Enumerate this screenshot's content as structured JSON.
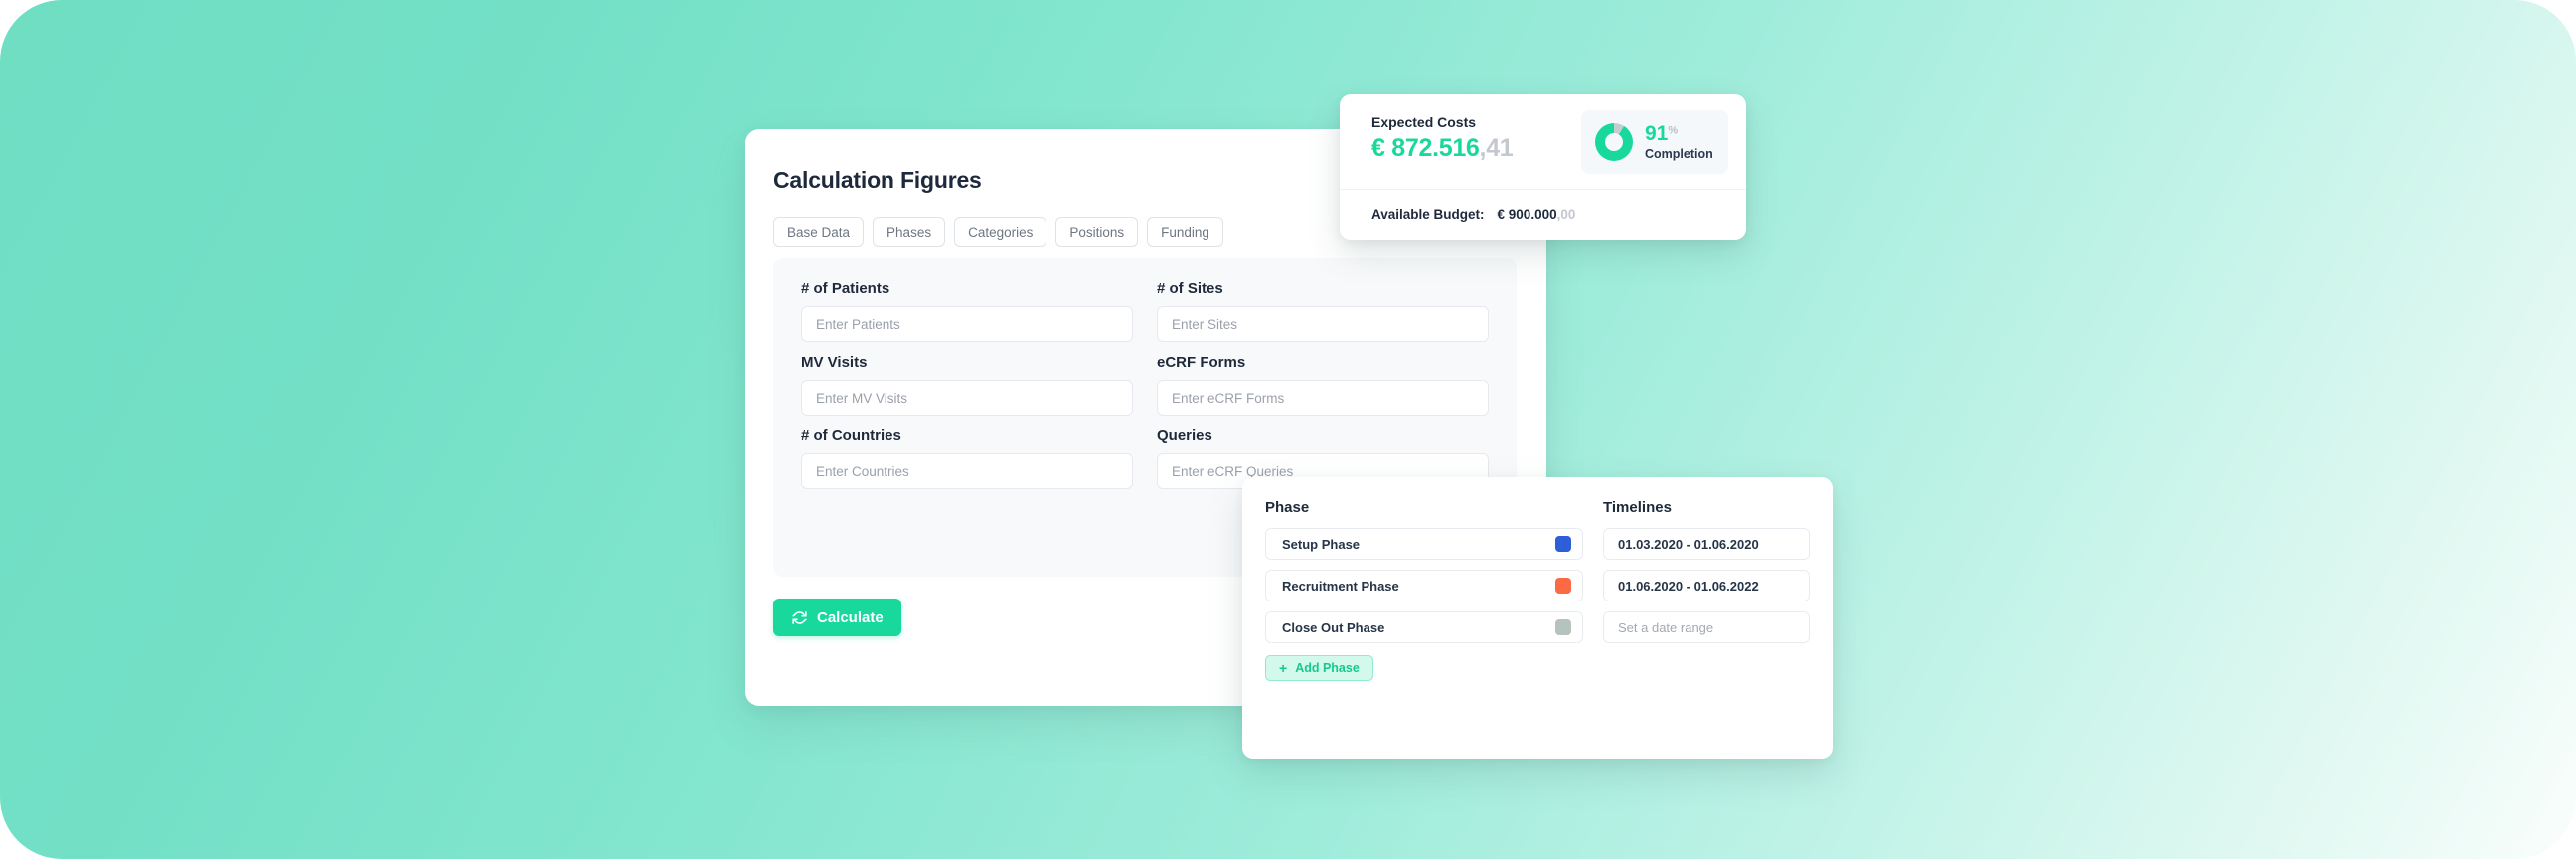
{
  "theme": {
    "accent_green": "#18d99b",
    "gradient_from": "#6fdec3",
    "gradient_to": "#fbfefd",
    "text_dark": "#1e2a3b"
  },
  "main_card": {
    "title": "Calculation Figures",
    "tabs": [
      {
        "label": "Base Data"
      },
      {
        "label": "Phases"
      },
      {
        "label": "Categories"
      },
      {
        "label": "Positions"
      },
      {
        "label": "Funding"
      }
    ],
    "fields": [
      {
        "label": "# of Patients",
        "value": "",
        "placeholder": "Enter Patients"
      },
      {
        "label": "# of Sites",
        "value": "",
        "placeholder": "Enter Sites"
      },
      {
        "label": "MV Visits",
        "value": "",
        "placeholder": "Enter MV Visits"
      },
      {
        "label": "eCRF Forms",
        "value": "",
        "placeholder": "Enter eCRF Forms"
      },
      {
        "label": "# of Countries",
        "value": "",
        "placeholder": "Enter Countries"
      },
      {
        "label": "Queries",
        "value": "",
        "placeholder": "Enter eCRF Queries"
      }
    ],
    "calculate_label": "Calculate",
    "calculate_icon": "refresh-icon"
  },
  "costs_card": {
    "label": "Expected Costs",
    "currency": "€",
    "amount_main": "872.516",
    "amount_cents": ",41",
    "amount_full": "€ 872.516,41",
    "completion": {
      "value": "91",
      "percent_sign": "%",
      "caption": "Completion",
      "progress": 91,
      "icon": "donut-chart-icon",
      "fill_color": "#18d99b",
      "track_color": "#c5cdd2"
    },
    "budget_label": "Available Budget:",
    "budget_main": "€ 900.000",
    "budget_cents": ",00",
    "budget_full": "€ 900.000,00"
  },
  "phase_card": {
    "columns": {
      "phase": "Phase",
      "timelines": "Timelines"
    },
    "rows": [
      {
        "name": "Setup Phase",
        "color": "#2e5fd8",
        "timeline": "01.03.2020 - 01.06.2020",
        "timeline_empty": false
      },
      {
        "name": "Recruitment Phase",
        "color": "#fb6a45",
        "timeline": "01.06.2020 - 01.06.2022",
        "timeline_empty": false
      },
      {
        "name": "Close Out Phase",
        "color": "#b6c2bd",
        "timeline": "Set a date range",
        "timeline_empty": true
      }
    ],
    "add_button": {
      "plus": "+",
      "label": "Add Phase"
    }
  }
}
